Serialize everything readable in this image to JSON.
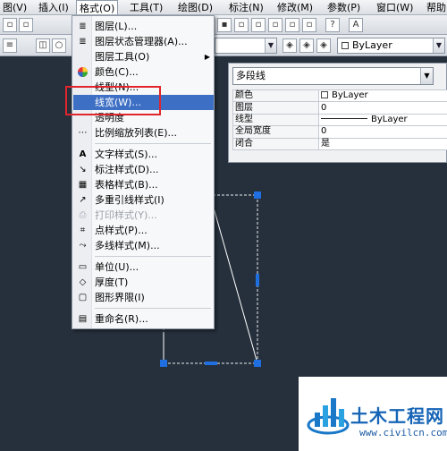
{
  "menubar": {
    "items": [
      {
        "label": "图(V)"
      },
      {
        "label": "插入(I)"
      },
      {
        "label": "格式(O)"
      },
      {
        "label": "工具(T)"
      },
      {
        "label": "绘图(D)"
      },
      {
        "label": "标注(N)"
      },
      {
        "label": "修改(M)"
      },
      {
        "label": "参数(P)"
      },
      {
        "label": "窗口(W)"
      },
      {
        "label": "帮助"
      }
    ],
    "active": "格式(O)"
  },
  "toolbar2": {
    "layer_combo": "ByLayer"
  },
  "format_menu": {
    "items": [
      {
        "label": "图层(L)...",
        "icon": "layer-icon"
      },
      {
        "label": "图层状态管理器(A)...",
        "icon": "layer-state-icon"
      },
      {
        "label": "图层工具(O)",
        "icon": "",
        "submenu": true
      },
      {
        "label": "颜色(C)...",
        "icon": "color-wheel-icon"
      },
      {
        "label": "线型(N)...",
        "icon": ""
      },
      {
        "label": "线宽(W)...",
        "icon": "",
        "highlighted": true
      },
      {
        "label": "透明度",
        "icon": ""
      },
      {
        "label": "比例缩放列表(E)...",
        "icon": "scale-list-icon"
      },
      {
        "label": "文字样式(S)...",
        "icon": "text-style-icon"
      },
      {
        "label": "标注样式(D)...",
        "icon": "dimension-style-icon"
      },
      {
        "label": "表格样式(B)...",
        "icon": "table-style-icon"
      },
      {
        "label": "多重引线样式(I)",
        "icon": "multileader-style-icon"
      },
      {
        "label": "打印样式(Y)...",
        "icon": "plot-style-icon",
        "disabled": true
      },
      {
        "label": "点样式(P)...",
        "icon": "point-style-icon"
      },
      {
        "label": "多线样式(M)...",
        "icon": "multiline-style-icon"
      },
      {
        "label": "单位(U)...",
        "icon": "units-icon"
      },
      {
        "label": "厚度(T)",
        "icon": "thickness-icon"
      },
      {
        "label": "图形界限(I)",
        "icon": "limits-icon"
      },
      {
        "label": "重命名(R)...",
        "icon": "rename-icon"
      }
    ]
  },
  "properties": {
    "selection": "多段线",
    "rows": [
      {
        "key": "颜色",
        "value": "ByLayer",
        "swatch": true
      },
      {
        "key": "图层",
        "value": "0"
      },
      {
        "key": "线型",
        "value": "ByLayer",
        "line": true
      },
      {
        "key": "全局宽度",
        "value": "0"
      },
      {
        "key": "闭合",
        "value": "是"
      }
    ]
  },
  "watermark": {
    "text": "土木工程网",
    "url": "www.civilcn.com"
  },
  "colors": {
    "canvas": "#26303c",
    "highlight": "#3d6fc4",
    "annotation_box": "#e0262c",
    "grip": "#1f6fe0"
  }
}
